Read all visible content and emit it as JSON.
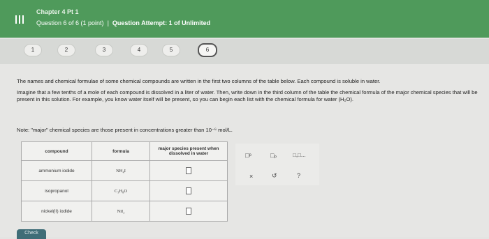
{
  "header": {
    "chapter": "Chapter 4 Pt 1",
    "question_info": "Question 6 of 6 (1 point)",
    "attempt_info": "Question Attempt: 1 of Unlimited"
  },
  "questions": [
    "1",
    "2",
    "3",
    "4",
    "5",
    "6"
  ],
  "active_question": "6",
  "intro_text_1": "The names and chemical formulae of some chemical compounds are written in the first two columns of the table below. Each compound is soluble in water.",
  "intro_text_2": "Imagine that a few tenths of a mole of each compound is dissolved in a liter of water. Then, write down in the third column of the table the chemical formula of the major chemical species that will be present in this solution. For example, you know water itself will be present, so you can begin each list with the chemical formula for water (H₂O).",
  "note_text": "Note: \"major\" chemical species are those present in concentrations greater than 10⁻⁶ mol/L.",
  "table": {
    "headers": [
      "compound",
      "formula",
      "major species present when dissolved in water"
    ],
    "rows": [
      {
        "compound": "ammonium iodide",
        "formula": "NH₄I"
      },
      {
        "compound": "isopropanol",
        "formula": "C₃H₈O"
      },
      {
        "compound": "nickel(II) iodide",
        "formula": "NiI₂"
      }
    ]
  },
  "tools": {
    "superscript": "□ᵖ",
    "subscript": "□ₚ",
    "sequence": "□,□...",
    "clear": "×",
    "undo": "↺",
    "help": "?"
  },
  "check_label": "Check"
}
